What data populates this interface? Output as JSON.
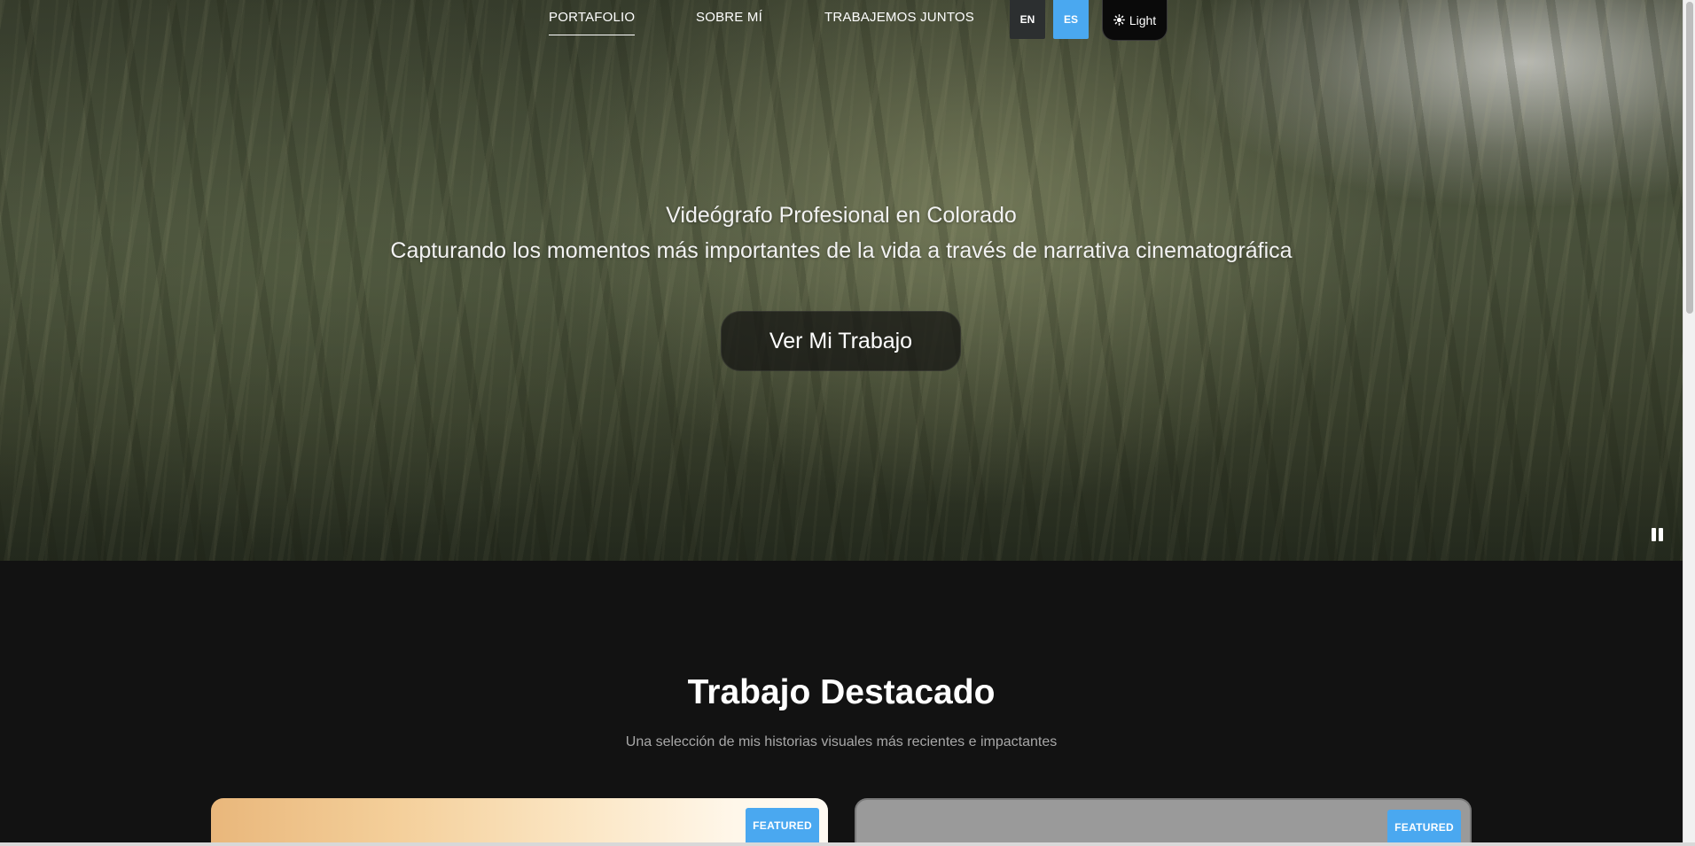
{
  "nav": {
    "links": [
      {
        "label": "PORTAFOLIO",
        "active": true
      },
      {
        "label": "SOBRE MÍ",
        "active": false
      },
      {
        "label": "TRABAJEMOS JUNTOS",
        "active": false
      }
    ],
    "languages": [
      {
        "code": "EN",
        "active": false
      },
      {
        "code": "ES",
        "active": true
      }
    ],
    "theme_toggle": {
      "label": "Light",
      "icon": "sun-icon"
    }
  },
  "hero": {
    "line1": "Videógrafo Profesional en Colorado",
    "line2": "Capturando los momentos más importantes de la vida a través de narrativa cinematográfica",
    "cta_label": "Ver Mi Trabajo",
    "video_control_icon": "pause-icon"
  },
  "featured": {
    "title": "Trabajo Destacado",
    "subtitle": "Una selección de mis historias visuales más recientes e impactantes",
    "cards": [
      {
        "badge": "FEATURED"
      },
      {
        "badge": "FEATURED"
      }
    ]
  },
  "colors": {
    "accent": "#4aa8f0",
    "background": "#121212",
    "lang_inactive": "#2c2f30"
  }
}
